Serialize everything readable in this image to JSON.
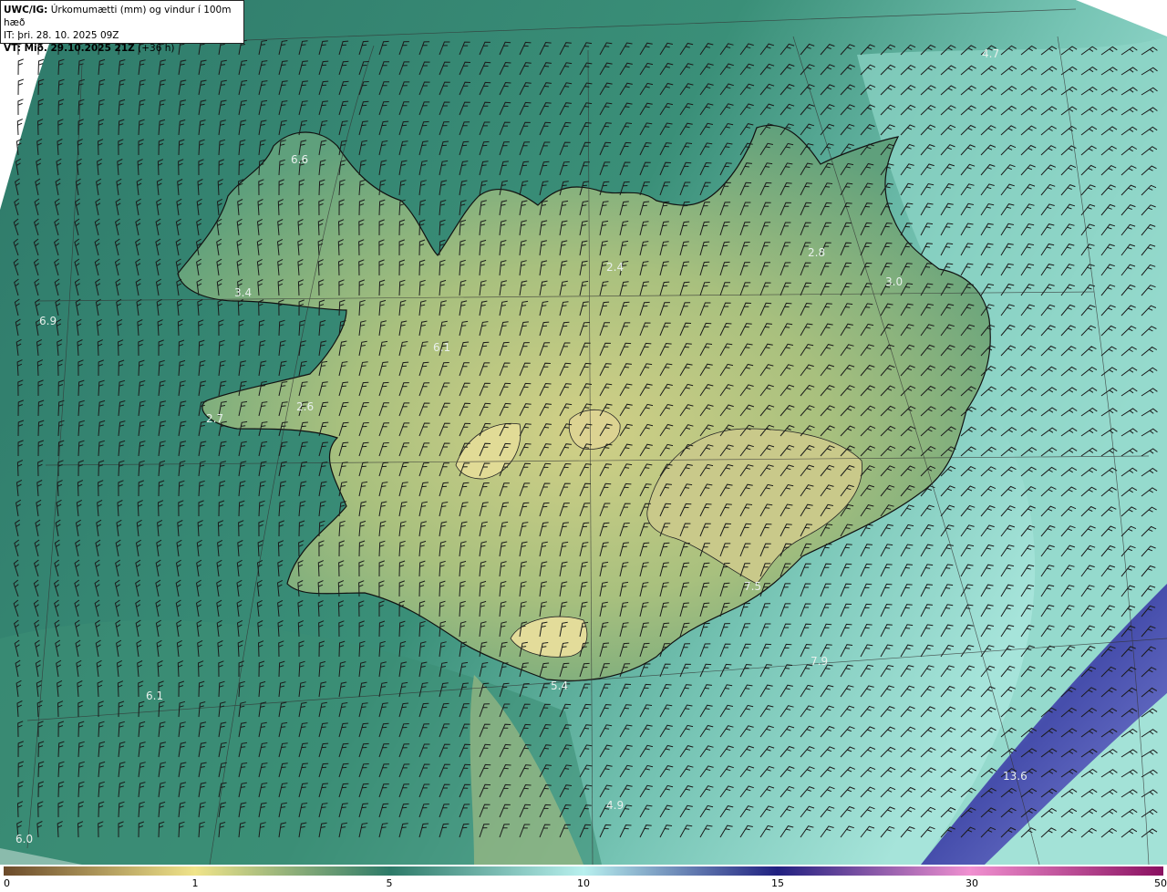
{
  "header": {
    "line1_bold": "UWC/IG:",
    "line1_text": "Úrkomumætti (mm) og vindur í 100m hæð",
    "line2_text": "IT: þri. 28. 10. 2025 09Z",
    "line3_bold": "VT: Mið. 29.10.2025 21Z",
    "line3_text": "(+36 h)"
  },
  "map_labels": [
    {
      "text": "4.7",
      "name": "label-4-7"
    },
    {
      "text": "6.6",
      "name": "label-6-6"
    },
    {
      "text": "2.4",
      "name": "label-2-4"
    },
    {
      "text": "2.8",
      "name": "label-2-8"
    },
    {
      "text": "3.0",
      "name": "label-3-0"
    },
    {
      "text": "3.4",
      "name": "label-3-4"
    },
    {
      "text": "6.9",
      "name": "label-6-9"
    },
    {
      "text": "6.1",
      "name": "label-6-1-north"
    },
    {
      "text": "2.6",
      "name": "label-2-6"
    },
    {
      "text": "2.7",
      "name": "label-2-7"
    },
    {
      "text": "7.5",
      "name": "label-7-5"
    },
    {
      "text": "7.9",
      "name": "label-7-9"
    },
    {
      "text": "5.4",
      "name": "label-5-4"
    },
    {
      "text": "6.1",
      "name": "label-6-1-south"
    },
    {
      "text": "13.6",
      "name": "label-13-6"
    },
    {
      "text": "4.9",
      "name": "label-4-9"
    },
    {
      "text": "6.0",
      "name": "label-6-0"
    }
  ],
  "colorbar": {
    "ticks": [
      "0",
      "1",
      "5",
      "10",
      "15",
      "30",
      "50"
    ],
    "colors": {
      "c0": "#6b4a2a",
      "c1": "#f0e48a",
      "c5": "#2d7a68",
      "c10": "#b8f0ee",
      "c15": "#202080",
      "c30": "#f090d0",
      "c50": "#8a1060"
    }
  },
  "map_colors": {
    "sea": "#2e7d6b",
    "land_low": "#5aa07a",
    "land_high": "#d6d68a",
    "east_sea": "#8fd4c6",
    "storm_band": "#5b5cc8",
    "coast": "#111111"
  }
}
